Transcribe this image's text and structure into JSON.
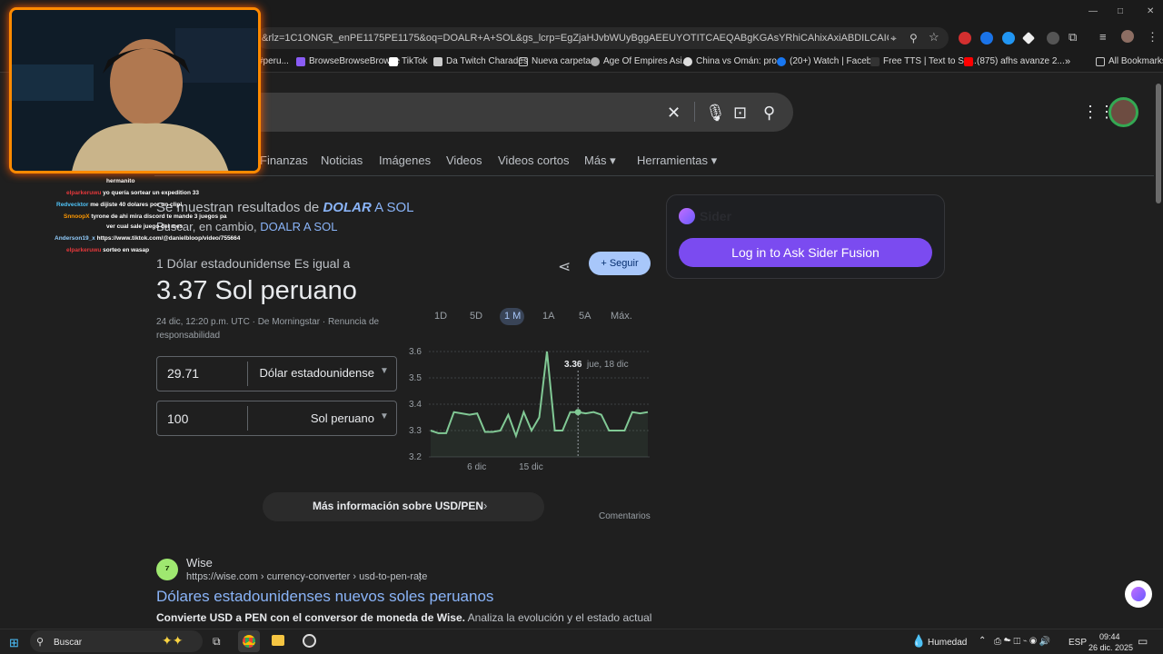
{
  "browser": {
    "url": "&rlz=1C1ONGR_enPE1175PE1175&oq=DOALR+A+SOL&gs_lcrp=EgZjaHJvbWUyBggAEEUYOTITCAEQABgKGAsYRhiCAhixAxiABDILCAIQABgKGAsYQxjgCAQyCwgDEAAYC...",
    "window_controls": [
      "—",
      "□",
      "✕"
    ]
  },
  "bookmarks": [
    {
      "label": "#peru...",
      "color": "#555"
    },
    {
      "label": "BrowseBrowseBrowse",
      "color": "#8a5cf6"
    },
    {
      "label": "TikTok",
      "color": "#ffffff"
    },
    {
      "label": "Da Twitch Charades",
      "color": "#cccccc"
    },
    {
      "label": "Nueva carpeta",
      "color": "#c8c8c8"
    },
    {
      "label": "Age Of Empires Asi...",
      "color": "#aaaaaa"
    },
    {
      "label": "China vs Omán: pro...",
      "color": "#dddddd"
    },
    {
      "label": "(20+) Watch | Faceb...",
      "color": "#1877f2"
    },
    {
      "label": "Free TTS | Text to Sp...",
      "color": "#333333"
    },
    {
      "label": "(875) afhs avanze 2...",
      "color": "#ff0000"
    },
    {
      "label": "All Bookmarks",
      "color": "#c8c8c8"
    }
  ],
  "search_tabs": [
    "Finanzas",
    "Noticias",
    "Imágenes",
    "Videos",
    "Videos cortos",
    "Más",
    "Herramientas"
  ],
  "chat": [
    {
      "name": "",
      "msg": "hermanito"
    },
    {
      "name": "elparkeruwu",
      "msg": "yo quería sortear un expedition 33"
    },
    {
      "name": "Redvecktor",
      "msg": "me dijiste 40 dolares por un clip!"
    },
    {
      "name": "SnnoopX",
      "msg": "tyrone de ahi mira discord te mande 3 juegos pa"
    },
    {
      "name": "",
      "msg": "ver cual sale juego del mes"
    },
    {
      "name": "Anderson19_x",
      "msg": "https://www.tiktok.com/@danielbloop/video/755664"
    },
    {
      "name": "elparkeruwu",
      "msg": "sorteo en wasap"
    }
  ],
  "results_note": {
    "prefix": "Se muestran resultados de",
    "query_bold": "DOLAR",
    "query_rest": "A SOL",
    "alt_prefix": "Buscar, en cambio,",
    "alt_link": "DOALR A SOL"
  },
  "currency": {
    "subtitle": "1 Dólar estadounidense Es igual a",
    "result": "3.37 Sol peruano",
    "timestamp": "24 dic, 12:20 p.m. UTC · De Morningstar · Renuncia de",
    "timestamp2": "responsabilidad",
    "follow": "Seguir",
    "from_value": "29.71",
    "from_currency": "Dólar estadounidense",
    "to_value": "100",
    "to_currency": "Sol peruano",
    "ranges": [
      "1D",
      "5D",
      "1 M",
      "1A",
      "5A",
      "Máx."
    ],
    "more_info": "Más información sobre USD/PEN",
    "feedback": "Comentarios"
  },
  "chart_data": {
    "type": "line",
    "y_ticks": [
      "3.6",
      "3.5",
      "3.4",
      "3.3",
      "3.2"
    ],
    "x_ticks": [
      "6 dic",
      "15 dic"
    ],
    "ylim": [
      3.2,
      3.6
    ],
    "values": [
      3.3,
      3.29,
      3.29,
      3.37,
      3.365,
      3.36,
      3.365,
      3.295,
      3.295,
      3.3,
      3.36,
      3.28,
      3.37,
      3.3,
      3.35,
      3.6,
      3.3,
      3.3,
      3.37,
      3.37,
      3.365,
      3.37,
      3.36,
      3.3,
      3.3,
      3.3,
      3.37,
      3.365,
      3.37
    ],
    "tooltip_value": "3.36",
    "tooltip_date": "jue, 18 dic",
    "series_color": "#81c995"
  },
  "result": {
    "site": "Wise",
    "url": "https://wise.com › currency-converter › usd-to-pen-rate",
    "title": "Dólares estadounidenses nuevos soles peruanos",
    "snippet_bold": "Convierte USD a PEN con el conversor de moneda de Wise.",
    "snippet_rest": " Analiza la evolución y el estado actual"
  },
  "sider": {
    "name": "Sider",
    "button": "Log in to Ask Sider Fusion"
  },
  "taskbar": {
    "search": "Buscar",
    "weather": "Humedad",
    "lang": "ESP",
    "time": "09:44",
    "date": "26 dic. 2025"
  }
}
